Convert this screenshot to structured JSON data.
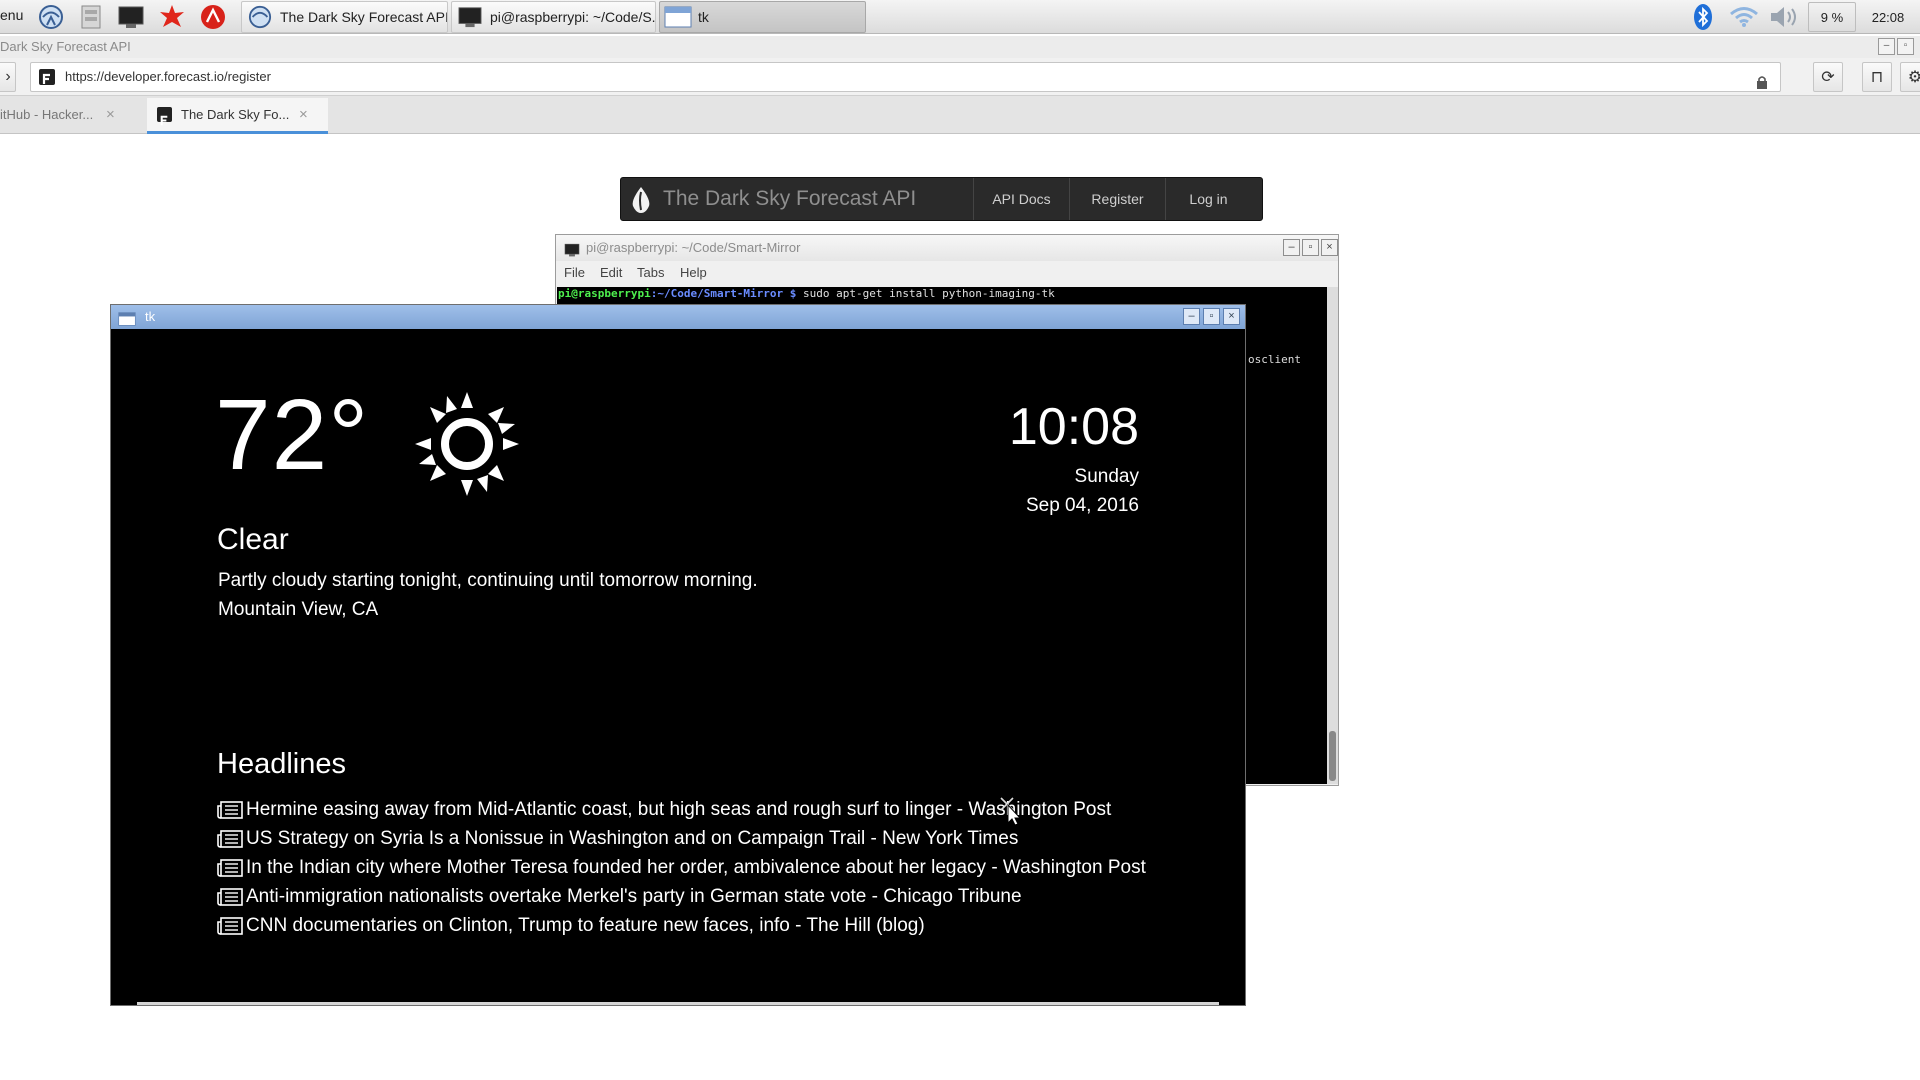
{
  "taskbar": {
    "menu_label": "enu",
    "tasks": [
      {
        "label": "The Dark Sky Forecast API"
      },
      {
        "label": "pi@raspberrypi: ~/Code/S..."
      },
      {
        "label": "tk"
      }
    ],
    "battery": "9 %",
    "clock": "22:08"
  },
  "browser": {
    "window_title": "Dark Sky Forecast API",
    "url": "https://developer.forecast.io/register",
    "tabs": [
      {
        "label": "itHub - Hacker..."
      },
      {
        "label": "The Dark Sky Fo..."
      }
    ],
    "tab_close": "×"
  },
  "darksky": {
    "brand": "The Dark Sky Forecast API",
    "links": [
      "API Docs",
      "Register",
      "Log in"
    ]
  },
  "terminal": {
    "title": "pi@raspberrypi: ~/Code/Smart-Mirror",
    "menu": [
      "File",
      "Edit",
      "Tabs",
      "Help"
    ],
    "prompt_user": "pi@raspberrypi",
    "prompt_path": ":~/Code/Smart-Mirror $",
    "command": " sudo apt-get install python-imaging-tk",
    "fragment": "osclient"
  },
  "tk": {
    "title": "tk",
    "temperature": "72°",
    "summary": "Clear",
    "forecast": "Partly cloudy starting tonight, continuing until tomorrow morning.",
    "location": "Mountain View, CA",
    "time": "10:08",
    "day_of_week": "Sunday",
    "date": "Sep 04, 2016",
    "headlines_title": "Headlines",
    "headlines": [
      "Hermine easing away from Mid-Atlantic coast, but high seas and rough surf to linger - Washington Post",
      "US Strategy on Syria Is a Nonissue in Washington and on Campaign Trail - New York Times",
      "In the Indian city where Mother Teresa founded her order, ambivalence about her legacy - Washington Post",
      "Anti-immigration nationalists overtake Merkel's party in German state vote - Chicago Tribune",
      "CNN documentaries on Clinton, Trump to feature new faces, info - The Hill (blog)"
    ]
  },
  "colors": {
    "accent_tab": "#4a90d9",
    "tk_titlebar": "#8fb0de",
    "prompt_green": "#4ef04e",
    "prompt_blue": "#6a8cff",
    "mirror_bg": "#000000",
    "mirror_fg": "#ffffff"
  }
}
